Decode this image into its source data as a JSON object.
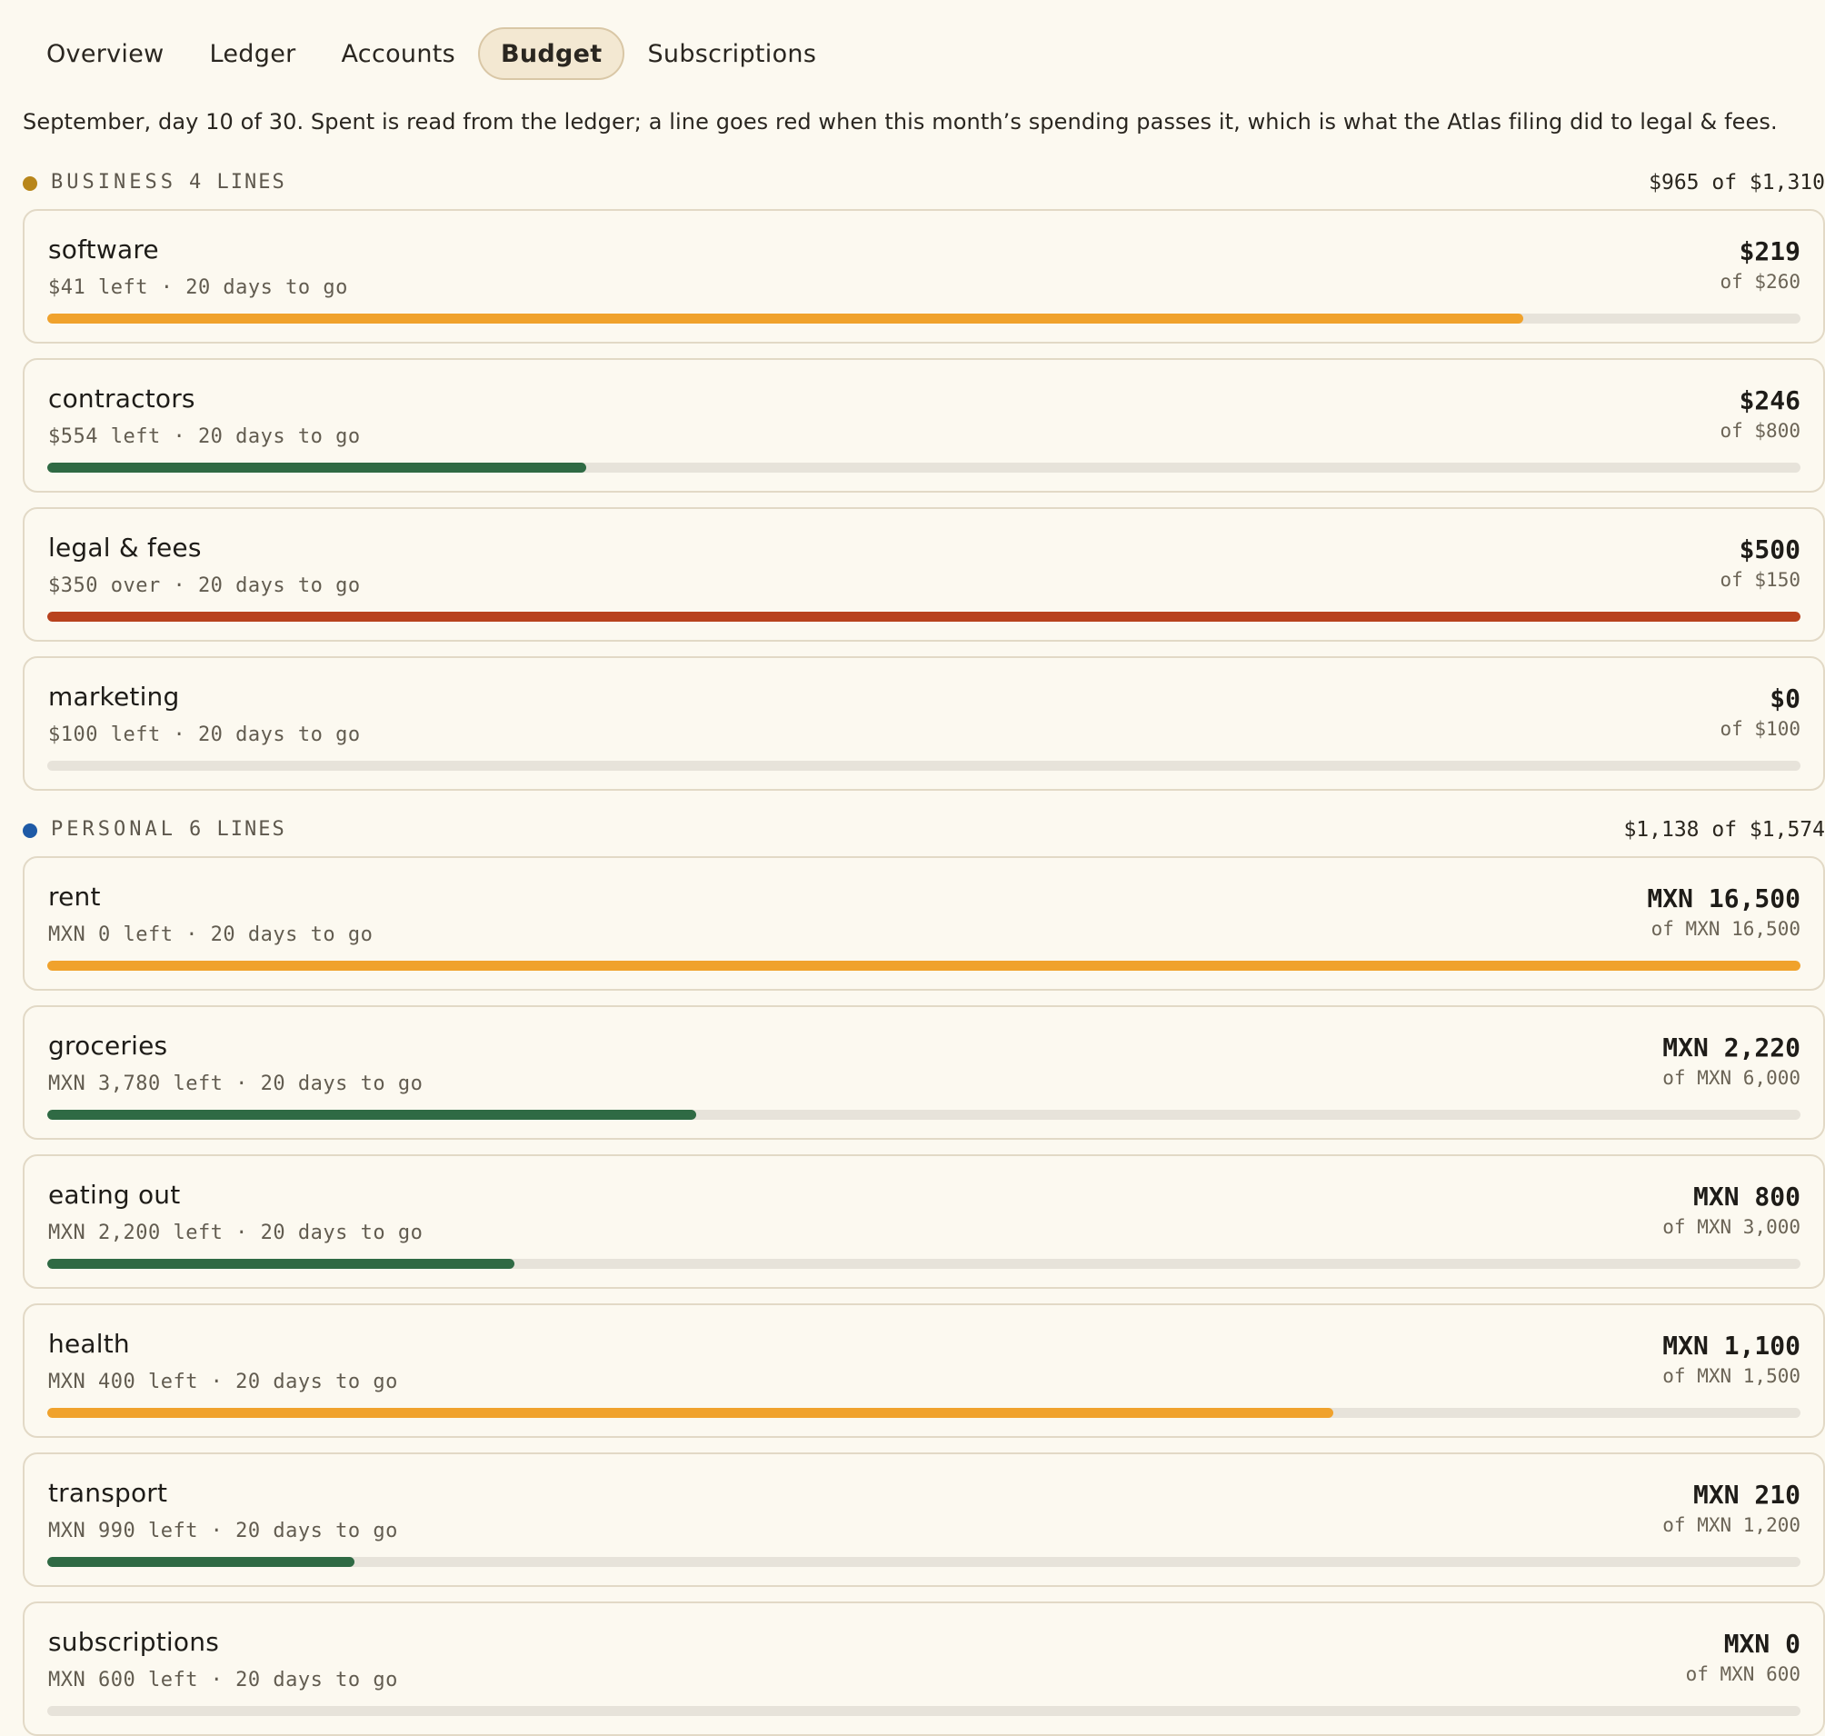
{
  "nav": {
    "tabs": [
      {
        "label": "Overview",
        "active": false
      },
      {
        "label": "Ledger",
        "active": false
      },
      {
        "label": "Accounts",
        "active": false
      },
      {
        "label": "Budget",
        "active": true
      },
      {
        "label": "Subscriptions",
        "active": false
      }
    ]
  },
  "intro": "September, day 10 of 30. Spent is read from the ledger; a line goes red when this month’s spending passes it, which is what the Atlas filing did to legal & fees.",
  "colors": {
    "under": "#2f6a44",
    "near": "#f0a22c",
    "over": "#b8421e",
    "business_dot": "#b8861a",
    "personal_dot": "#1e5aa6"
  },
  "groups": [
    {
      "name": "BUSINESS",
      "count": "4 LINES",
      "total": "$965 of $1,310",
      "dot": "business_dot",
      "lines": [
        {
          "name": "software",
          "status": "$41 left · 20 days to go",
          "spent": "$219",
          "budget": "of $260",
          "progress": 0.842,
          "state": "near"
        },
        {
          "name": "contractors",
          "status": "$554 left · 20 days to go",
          "spent": "$246",
          "budget": "of $800",
          "progress": 0.3075,
          "state": "under"
        },
        {
          "name": "legal & fees",
          "status": "$350 over · 20 days to go",
          "spent": "$500",
          "budget": "of $150",
          "progress": 1.0,
          "state": "over"
        },
        {
          "name": "marketing",
          "status": "$100 left · 20 days to go",
          "spent": "$0",
          "budget": "of $100",
          "progress": 0.0,
          "state": "under"
        }
      ]
    },
    {
      "name": "PERSONAL",
      "count": "6 LINES",
      "total": "$1,138 of $1,574",
      "dot": "personal_dot",
      "lines": [
        {
          "name": "rent",
          "status": "MXN 0 left · 20 days to go",
          "spent": "MXN 16,500",
          "budget": "of MXN 16,500",
          "progress": 1.0,
          "state": "near"
        },
        {
          "name": "groceries",
          "status": "MXN 3,780 left · 20 days to go",
          "spent": "MXN 2,220",
          "budget": "of MXN 6,000",
          "progress": 0.37,
          "state": "under"
        },
        {
          "name": "eating out",
          "status": "MXN 2,200 left · 20 days to go",
          "spent": "MXN 800",
          "budget": "of MXN 3,000",
          "progress": 0.2667,
          "state": "under"
        },
        {
          "name": "health",
          "status": "MXN 400 left · 20 days to go",
          "spent": "MXN 1,100",
          "budget": "of MXN 1,500",
          "progress": 0.7333,
          "state": "near"
        },
        {
          "name": "transport",
          "status": "MXN 990 left · 20 days to go",
          "spent": "MXN 210",
          "budget": "of MXN 1,200",
          "progress": 0.175,
          "state": "under"
        },
        {
          "name": "subscriptions",
          "status": "MXN 600 left · 20 days to go",
          "spent": "MXN 0",
          "budget": "of MXN 600",
          "progress": 0.0,
          "state": "under"
        }
      ]
    }
  ]
}
